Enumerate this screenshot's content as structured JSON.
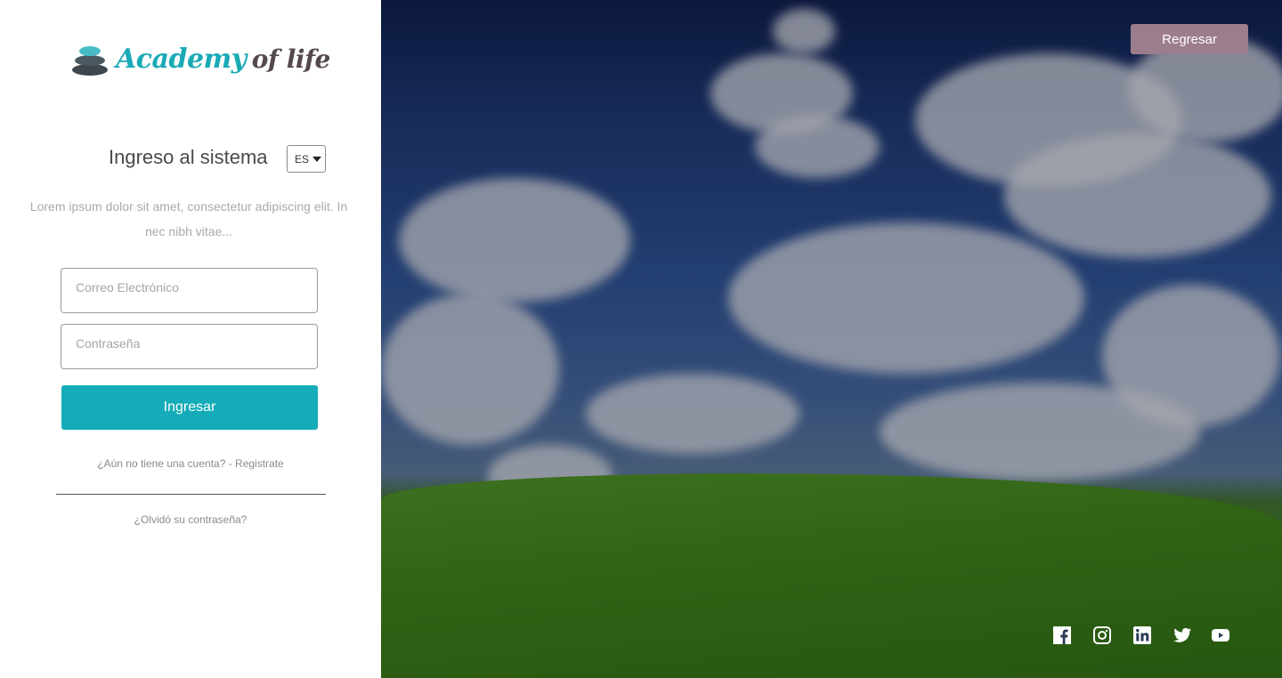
{
  "brand": {
    "part1": "Academy",
    "part2": "of life"
  },
  "login": {
    "title": "Ingreso al sistema",
    "language": "ES",
    "intro": "Lorem ipsum dolor sit amet, consectetur adipiscing elit. In nec nibh vitae...",
    "email_placeholder": "Correo Electrónico",
    "password_placeholder": "Contraseña",
    "submit_label": "Ingresar",
    "register_text": "¿Aún no tiene una cuenta? - Registrate",
    "forgot_text": "¿Olvidó su contraseña?"
  },
  "header": {
    "back_label": "Regresar"
  },
  "social": [
    "facebook-icon",
    "instagram-icon",
    "linkedin-icon",
    "twitter-icon",
    "youtube-icon"
  ],
  "colors": {
    "accent": "#14acb8",
    "back_button": "#9c7d8e",
    "brand_dark": "#55484e"
  }
}
